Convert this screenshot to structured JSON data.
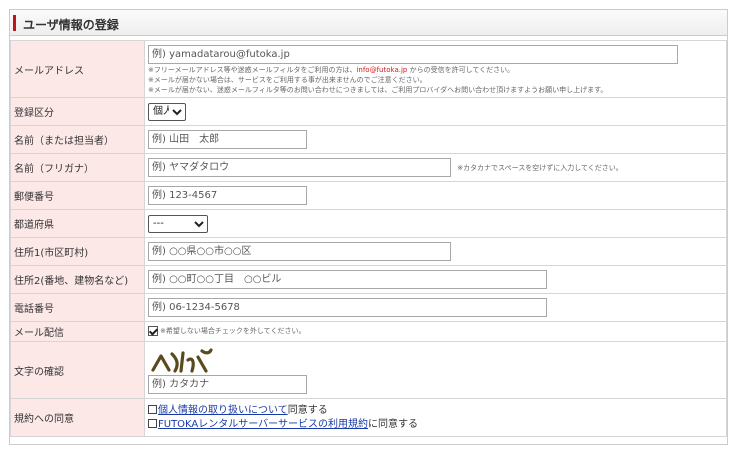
{
  "section": {
    "title": "ユーザ情報の登録"
  },
  "colors": {
    "accent": "#c0131b",
    "label_bg": "#fde8e8",
    "link": "#1a3aa8",
    "warn": "#d01a1a"
  },
  "fields": {
    "email": {
      "label": "メールアドレス",
      "placeholder": "例) yamadatarou@futoka.jp",
      "note1_pre": "※フリーメールアドレス等や迷惑メールフィルタをご利用の方は、",
      "note1_addr": "info@futoka.jp",
      "note1_post": " からの受信を許可してください。",
      "note2": "※メールが届かない場合は、サービスをご利用する事が出来ませんのでご注意ください。",
      "note3": "※メールが届かない、迷惑メールフィルタ等のお問い合わせにつきましては、ご利用プロバイダへお問い合わせ頂けますようお願い申し上げます。"
    },
    "reg_type": {
      "label": "登録区分",
      "selected": "個人"
    },
    "name": {
      "label": "名前（または担当者）",
      "placeholder": "例) 山田　太郎"
    },
    "kana": {
      "label": "名前（フリガナ）",
      "placeholder": "例) ヤマダタロウ",
      "note": "※カタカナでスペースを空けずに入力してください。"
    },
    "zip": {
      "label": "郵便番号",
      "placeholder": "例) 123-4567"
    },
    "pref": {
      "label": "都道府県",
      "selected": "---"
    },
    "addr1": {
      "label": "住所1(市区町村)",
      "placeholder": "例) ○○県○○市○○区"
    },
    "addr2": {
      "label": "住所2(番地、建物名など)",
      "placeholder": "例) ○○町○○丁目　○○ビル"
    },
    "tel": {
      "label": "電話番号",
      "placeholder": "例) 06-1234-5678"
    },
    "mail_delivery": {
      "label": "メール配信",
      "checked": true,
      "note": "※希望しない場合チェックを外してください。"
    },
    "captcha": {
      "label": "文字の確認",
      "image_text": "ヘオパピ",
      "placeholder": "例) カタカナ"
    },
    "terms": {
      "label": "規約への同意",
      "privacy_link": "個人情報の取り扱いについて",
      "privacy_suffix": "同意する",
      "service_link": "FUTOKAレンタルサーバーサービスの利用規約",
      "service_suffix": "に同意する"
    }
  }
}
